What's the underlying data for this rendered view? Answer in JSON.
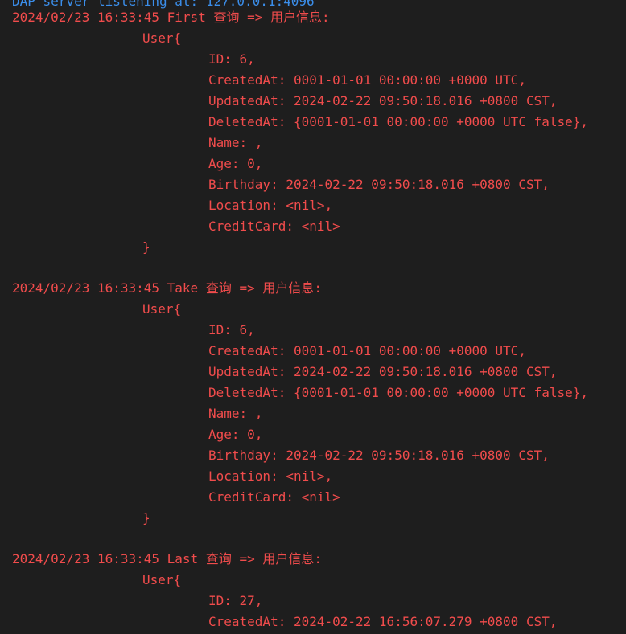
{
  "terminal": {
    "header": "DAP server listening at: 127.0.0.1:4096",
    "colors": {
      "background": "#1e1e1e",
      "log": "#f14c4c",
      "info": "#3b8eea"
    },
    "blocks": [
      {
        "heading": "2024/02/23 16:33:45 First 查询 => 用户信息:",
        "open": "User{",
        "fields": [
          "ID: 6,",
          "CreatedAt: 0001-01-01 00:00:00 +0000 UTC,",
          "UpdatedAt: 2024-02-22 09:50:18.016 +0800 CST,",
          "DeletedAt: {0001-01-01 00:00:00 +0000 UTC false},",
          "Name: ,",
          "Age: 0,",
          "Birthday: 2024-02-22 09:50:18.016 +0800 CST,",
          "Location: <nil>,",
          "CreditCard: <nil>"
        ],
        "close": "}"
      },
      {
        "heading": "2024/02/23 16:33:45 Take 查询 => 用户信息:",
        "open": "User{",
        "fields": [
          "ID: 6,",
          "CreatedAt: 0001-01-01 00:00:00 +0000 UTC,",
          "UpdatedAt: 2024-02-22 09:50:18.016 +0800 CST,",
          "DeletedAt: {0001-01-01 00:00:00 +0000 UTC false},",
          "Name: ,",
          "Age: 0,",
          "Birthday: 2024-02-22 09:50:18.016 +0800 CST,",
          "Location: <nil>,",
          "CreditCard: <nil>"
        ],
        "close": "}"
      },
      {
        "heading": "2024/02/23 16:33:45 Last 查询 => 用户信息:",
        "open": "User{",
        "fields": [
          "ID: 27,",
          "CreatedAt: 2024-02-22 16:56:07.279 +0800 CST,"
        ]
      }
    ]
  }
}
